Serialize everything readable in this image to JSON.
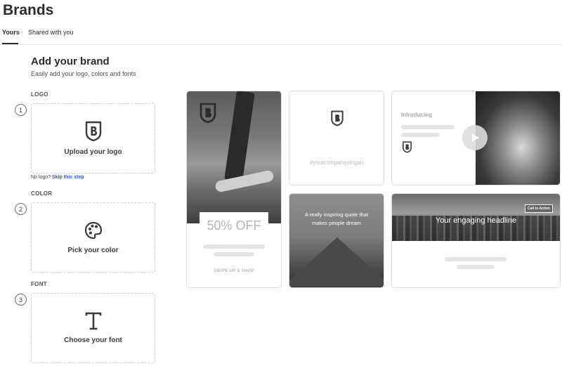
{
  "header": {
    "title": "Brands"
  },
  "tabs": [
    {
      "label": "Yours",
      "active": true
    },
    {
      "label": "Shared with you",
      "active": false
    }
  ],
  "section": {
    "title": "Add your brand",
    "subtitle": "Easily add your logo, colors and fonts"
  },
  "steps": [
    {
      "number": "1",
      "label": "LOGO",
      "box_label": "Upload your logo",
      "icon": "brand-shield-icon"
    },
    {
      "number": "2",
      "label": "COLOR",
      "box_label": "Pick your color",
      "icon": "palette-icon"
    },
    {
      "number": "3",
      "label": "FONT",
      "box_label": "Choose your font",
      "icon": "type-icon"
    }
  ],
  "skip": {
    "prefix": "No logo?",
    "link": "Skip this step"
  },
  "previews": {
    "story": {
      "offer": "50% OFF",
      "cta": "SWIPE UP & SHOP"
    },
    "slogan": {
      "text": "#yourcompanyslogan"
    },
    "video": {
      "intro": "Introducing"
    },
    "quote": {
      "text": "A really inspiring quote that makes people dream"
    },
    "banner": {
      "headline": "Your engaging headline",
      "button": "Call to Action"
    }
  },
  "colors": {
    "text": "#2c2c2c",
    "link": "#2b5fd9",
    "placeholder_bar": "#e4e4e4"
  }
}
